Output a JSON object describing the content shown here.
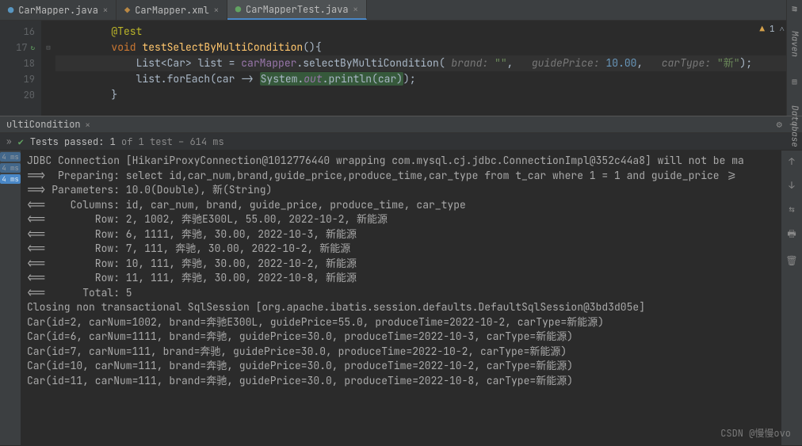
{
  "tabs": [
    {
      "icon": "C",
      "label": "CarMapper.java",
      "active": false
    },
    {
      "icon": "X",
      "label": "CarMapper.xml",
      "active": false
    },
    {
      "icon": "T",
      "label": "CarMapperTest.java",
      "active": true
    }
  ],
  "warning": {
    "count": "1"
  },
  "gutter": {
    "lines": [
      "16",
      "17",
      "18",
      "19",
      "20"
    ]
  },
  "code": {
    "l16": "@Test",
    "l17_kw": "void",
    "l17_name": "testSelectByMultiCondition",
    "l17_tail": "(){",
    "l18_a": "List<Car> list = ",
    "l18_b": "carMapper",
    "l18_c": ".selectByMultiCondition(",
    "l18_h1": " brand: ",
    "l18_s1": "\"\"",
    "l18_h2": "   guidePrice: ",
    "l18_n1": "10.00",
    "l18_h3": "   carType: ",
    "l18_s2": "\"新\"",
    "l18_d": ");",
    "l19_a": "list.forEach(car -> ",
    "l19_b": "System.",
    "l19_c": "out",
    "l19_d": ".println(car)",
    "l19_e": ");",
    "l20": "}"
  },
  "tool": {
    "title": "ultiCondition"
  },
  "tests": {
    "prefix": "Tests passed: ",
    "count": "1",
    "suffix": " of 1 test – 614 ms"
  },
  "left_pills": [
    "4 ms",
    "4 ms",
    "4 ms"
  ],
  "console_lines": [
    "JDBC Connection [HikariProxyConnection@1012776440 wrapping com.mysql.cj.jdbc.ConnectionImpl@352c44a8] will not be ma",
    "==>  Preparing: select id,car_num,brand,guide_price,produce_time,car_type from t_car where 1 = 1 and guide_price >=",
    "==> Parameters: 10.0(Double), 新(String)",
    "<==    Columns: id, car_num, brand, guide_price, produce_time, car_type",
    "<==        Row: 2, 1002, 奔驰E300L, 55.00, 2022-10-2, 新能源",
    "<==        Row: 6, 1111, 奔驰, 30.00, 2022-10-3, 新能源",
    "<==        Row: 7, 111, 奔驰, 30.00, 2022-10-2, 新能源",
    "<==        Row: 10, 111, 奔驰, 30.00, 2022-10-2, 新能源",
    "<==        Row: 11, 111, 奔驰, 30.00, 2022-10-8, 新能源",
    "<==      Total: 5",
    "Closing non transactional SqlSession [org.apache.ibatis.session.defaults.DefaultSqlSession@3bd3d05e]",
    "Car(id=2, carNum=1002, brand=奔驰E300L, guidePrice=55.0, produceTime=2022-10-2, carType=新能源)",
    "Car(id=6, carNum=1111, brand=奔驰, guidePrice=30.0, produceTime=2022-10-3, carType=新能源)",
    "Car(id=7, carNum=111, brand=奔驰, guidePrice=30.0, produceTime=2022-10-2, carType=新能源)",
    "Car(id=10, carNum=111, brand=奔驰, guidePrice=30.0, produceTime=2022-10-2, carType=新能源)",
    "Car(id=11, carNum=111, brand=奔驰, guidePrice=30.0, produceTime=2022-10-8, carType=新能源)"
  ],
  "watermark": "CSDN @慢慢ovo",
  "side": {
    "maven": "Maven",
    "database": "Database"
  }
}
